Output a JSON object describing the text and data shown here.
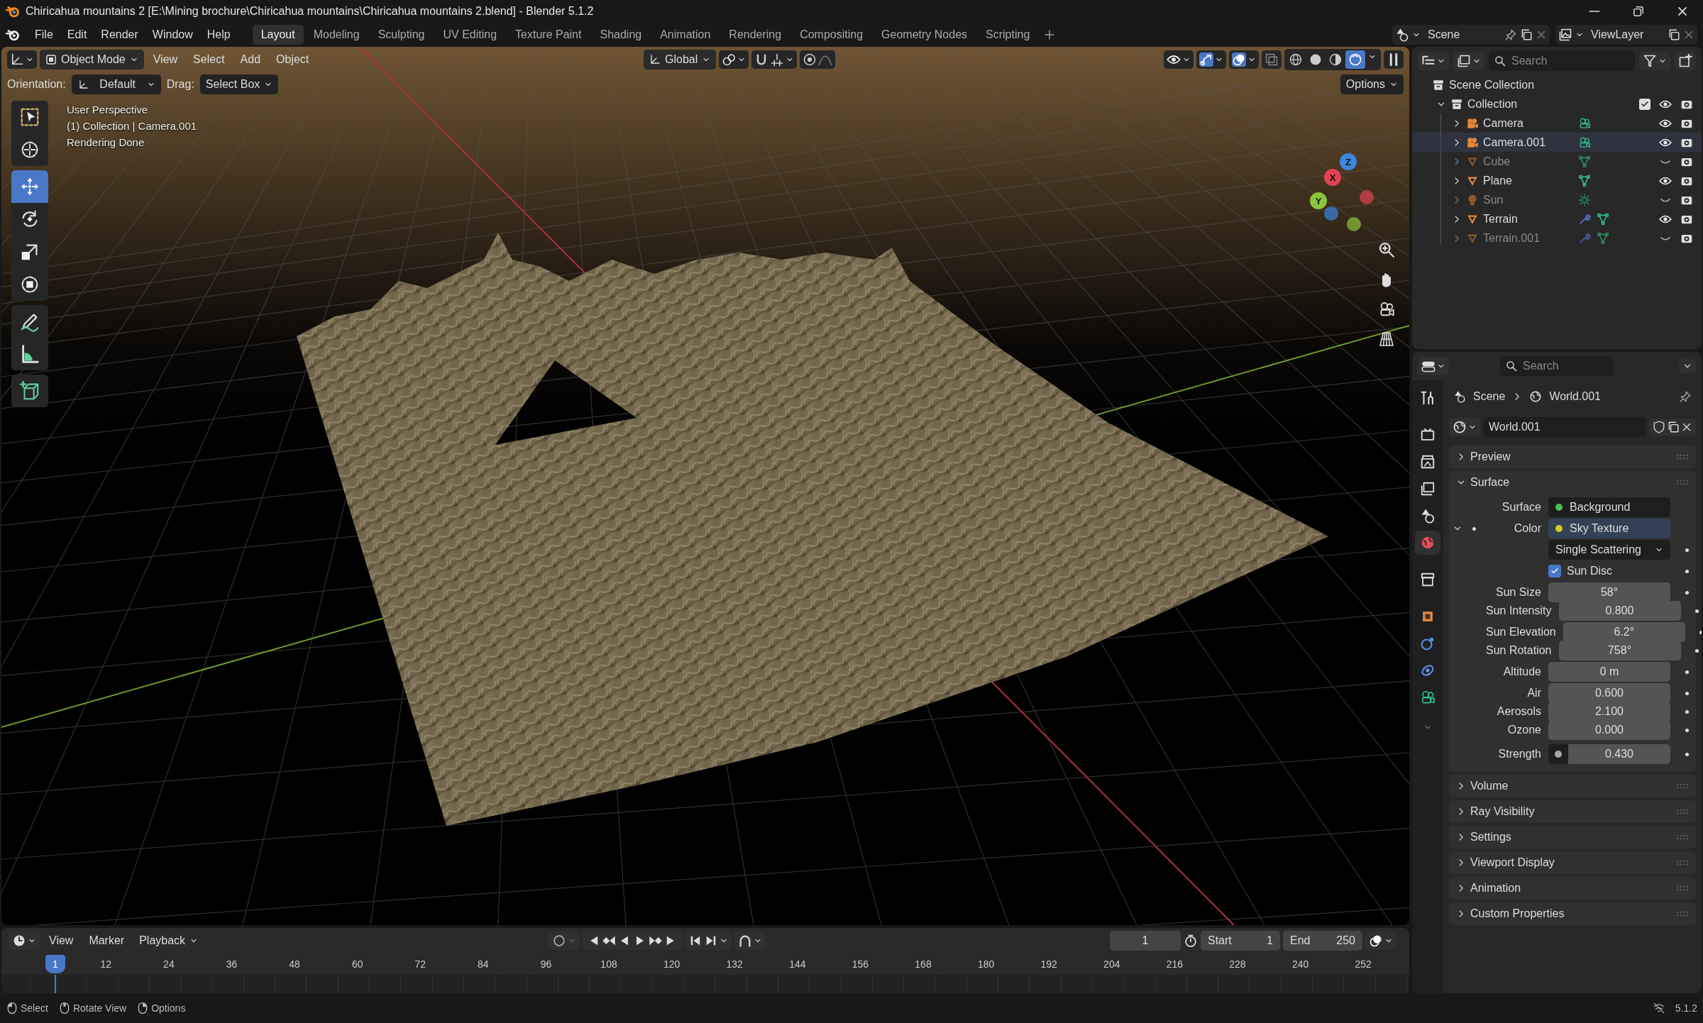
{
  "window": {
    "title": "Chiricahua mountains 2 [E:\\Mining brochure\\Chiricahua mountains\\Chiricahua mountains 2.blend] - Blender 5.1.2"
  },
  "menu": [
    "File",
    "Edit",
    "Render",
    "Window",
    "Help"
  ],
  "workspaces": [
    {
      "label": "Layout",
      "selected": true
    },
    {
      "label": "Modeling",
      "selected": false
    },
    {
      "label": "Sculpting",
      "selected": false
    },
    {
      "label": "UV Editing",
      "selected": false
    },
    {
      "label": "Texture Paint",
      "selected": false
    },
    {
      "label": "Shading",
      "selected": false
    },
    {
      "label": "Animation",
      "selected": false
    },
    {
      "label": "Rendering",
      "selected": false
    },
    {
      "label": "Compositing",
      "selected": false
    },
    {
      "label": "Geometry Nodes",
      "selected": false
    },
    {
      "label": "Scripting",
      "selected": false
    }
  ],
  "scene": "Scene",
  "view_layer": "ViewLayer",
  "viewport": {
    "mode": "Object Mode",
    "menus": [
      "View",
      "Select",
      "Add",
      "Object"
    ],
    "transform": "Global",
    "toggles": [
      {
        "kind": "gizmos",
        "on": true
      },
      {
        "kind": "overlays",
        "on": true
      },
      {
        "kind": "xray",
        "on": false
      }
    ],
    "shading": [
      {
        "kind": "wireframe",
        "selected": false
      },
      {
        "kind": "solid",
        "selected": false
      },
      {
        "kind": "material",
        "selected": false
      },
      {
        "kind": "rendered",
        "selected": true
      }
    ],
    "orientation_label": "Orientation:",
    "orientation": "Default",
    "drag_label": "Drag:",
    "drag": "Select Box",
    "options": "Options",
    "overlay_text": [
      "User Perspective",
      "(1) Collection | Camera.001",
      "Rendering Done"
    ],
    "tools": [
      {
        "kind": "select",
        "selected": false
      },
      {
        "kind": "cursor",
        "selected": false
      },
      {
        "kind": "move",
        "selected": true
      },
      {
        "kind": "rotate",
        "selected": false
      },
      {
        "kind": "scale",
        "selected": false
      },
      {
        "kind": "transform",
        "selected": false
      },
      {
        "kind": "annotate",
        "selected": false
      },
      {
        "kind": "measure",
        "selected": false
      },
      {
        "kind": "add_cube",
        "selected": false
      }
    ],
    "gizmo": [
      {
        "label": "X",
        "color": "#e0434f"
      },
      {
        "label": "Y",
        "color": "#8bc43c"
      },
      {
        "label": "Z",
        "color": "#3b86e0"
      }
    ]
  },
  "outliner": {
    "search_placeholder": "Search",
    "root": "Scene Collection",
    "collection": {
      "name": "Collection",
      "checked": true,
      "expanded": true,
      "children": [
        {
          "name": "Camera",
          "kind": "camera",
          "visible": true,
          "modifier": false,
          "selected": false
        },
        {
          "name": "Camera.001",
          "kind": "camera",
          "visible": true,
          "modifier": false,
          "selected": true
        },
        {
          "name": "Cube",
          "kind": "mesh",
          "visible": false,
          "modifier": false,
          "selected": false
        },
        {
          "name": "Plane",
          "kind": "mesh",
          "visible": true,
          "modifier": false,
          "selected": false
        },
        {
          "name": "Sun",
          "kind": "light",
          "visible": false,
          "modifier": false,
          "selected": false
        },
        {
          "name": "Terrain",
          "kind": "mesh",
          "visible": true,
          "modifier": true,
          "selected": false
        },
        {
          "name": "Terrain.001",
          "kind": "mesh",
          "visible": false,
          "modifier": true,
          "selected": false
        }
      ]
    }
  },
  "properties": {
    "search_placeholder": "Search",
    "tabs": [
      {
        "kind": "tool",
        "selected": false
      },
      {
        "kind": "render",
        "selected": false
      },
      {
        "kind": "output",
        "selected": false
      },
      {
        "kind": "view_layer",
        "selected": false
      },
      {
        "kind": "scene",
        "selected": false
      },
      {
        "kind": "world",
        "selected": true
      },
      {
        "kind": "collection",
        "selected": false
      },
      {
        "kind": "object",
        "selected": false
      },
      {
        "kind": "physics",
        "selected": false
      },
      {
        "kind": "constraints",
        "selected": false
      },
      {
        "kind": "camera_data",
        "selected": false
      }
    ],
    "breadcrumb": [
      "Scene",
      "World.001"
    ],
    "datablock": "World.001",
    "panels": [
      {
        "title": "Preview",
        "expanded": false
      },
      {
        "title": "Surface",
        "expanded": true,
        "rows": [
          {
            "kind": "link",
            "label": "Surface",
            "value": "Background",
            "color": "#4cc14f"
          },
          {
            "kind": "link",
            "label": "Color",
            "value": "Sky Texture",
            "color": "#d6c92e",
            "expanded": true
          },
          {
            "kind": "dropdown",
            "value": "Single Scattering"
          },
          {
            "kind": "checkbox",
            "label": "Sun Disc",
            "checked": true
          },
          {
            "kind": "number",
            "label": "Sun Size",
            "value": "58°"
          },
          {
            "kind": "number",
            "label": "Sun Intensity",
            "value": "0.800",
            "joined": true
          },
          {
            "kind": "number",
            "label": "Sun Elevation",
            "value": "6.2°"
          },
          {
            "kind": "number",
            "label": "Sun Rotation",
            "value": "758°",
            "joined": true
          },
          {
            "kind": "number",
            "label": "Altitude",
            "value": "0 m"
          },
          {
            "kind": "number",
            "label": "Air",
            "value": "0.600"
          },
          {
            "kind": "number",
            "label": "Aerosols",
            "value": "2.100",
            "joined": true
          },
          {
            "kind": "number",
            "label": "Ozone",
            "value": "0.000",
            "joined": true
          },
          {
            "kind": "socket",
            "label": "Strength",
            "value": "0.430"
          }
        ]
      },
      {
        "title": "Volume",
        "expanded": false
      },
      {
        "title": "Ray Visibility",
        "expanded": false
      },
      {
        "title": "Settings",
        "expanded": false
      },
      {
        "title": "Viewport Display",
        "expanded": false
      },
      {
        "title": "Animation",
        "expanded": false
      },
      {
        "title": "Custom Properties",
        "expanded": false
      }
    ]
  },
  "timeline": {
    "menus": [
      "View",
      "Marker",
      "Playback"
    ],
    "current_frame": "1",
    "start_label": "Start",
    "start": "1",
    "end_label": "End",
    "end": "250",
    "ticks": [
      "12",
      "24",
      "36",
      "48",
      "60",
      "72",
      "84",
      "96",
      "108",
      "120",
      "132",
      "144",
      "156",
      "168",
      "180",
      "192",
      "204",
      "216",
      "228",
      "240",
      "252"
    ],
    "playhead": "1"
  },
  "status_bar": {
    "hints": [
      "Select",
      "Rotate View",
      "Options"
    ],
    "version": "5.1.2"
  }
}
